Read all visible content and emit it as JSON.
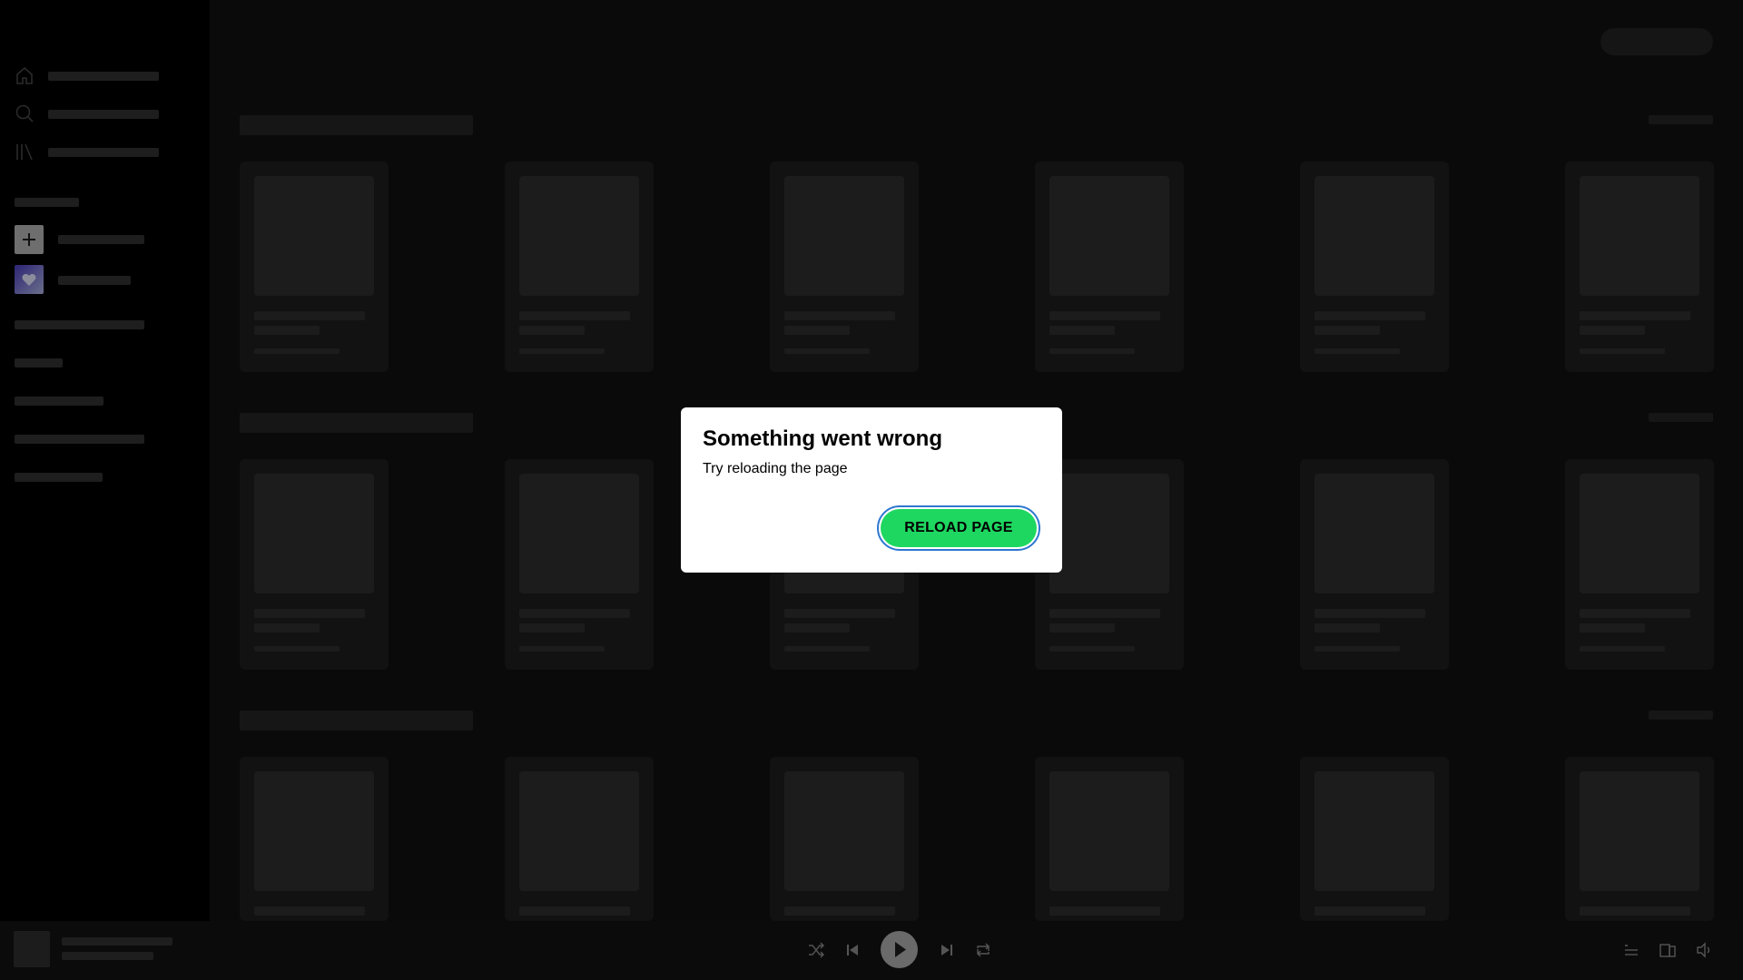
{
  "dialog": {
    "title": "Something went wrong",
    "message": "Try reloading the page",
    "reload_label": "RELOAD PAGE"
  },
  "sidebar": {
    "nav": [
      {
        "icon": "home-icon"
      },
      {
        "icon": "search-icon"
      },
      {
        "icon": "library-icon"
      }
    ],
    "actions": [
      {
        "icon": "plus-icon"
      },
      {
        "icon": "heart-icon"
      }
    ]
  },
  "player": {
    "controls": [
      "shuffle-icon",
      "previous-icon",
      "play-icon",
      "next-icon",
      "repeat-icon"
    ],
    "right_controls": [
      "queue-icon",
      "devices-icon",
      "volume-icon"
    ]
  },
  "colors": {
    "accent": "#1ed760",
    "focus_ring": "#2e77d0",
    "liked_songs_gradient_start": "#450af5",
    "liked_songs_gradient_end": "#c4efd9"
  }
}
